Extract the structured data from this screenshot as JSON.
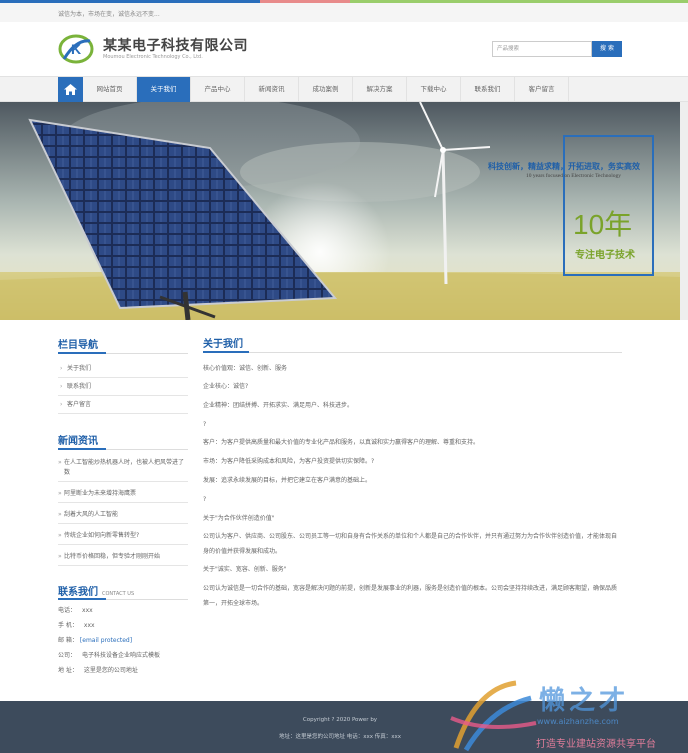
{
  "topbar": {
    "slogan": "诚信为本，市场在变，诚信永远不变...",
    "stripe_colors": [
      "#2a6ebb",
      "#e88b8b",
      "#9acd6b"
    ]
  },
  "header": {
    "company_name": "某某电子科技有限公司",
    "company_name_en": "Moumou Electronic Technology Co., Ltd.",
    "logo_letter": "K"
  },
  "search": {
    "placeholder": "产品搜索",
    "button": "搜 索"
  },
  "nav": {
    "home_icon": "home-icon",
    "items": [
      "网站首页",
      "关于我们",
      "产品中心",
      "新闻资讯",
      "成功案例",
      "解决方案",
      "下载中心",
      "联系我们",
      "客户留言"
    ],
    "active": 1
  },
  "banner": {
    "line1": "科技创新，精益求精，开拓进取，务实高效",
    "line2": "10 years focused on Electronic Technology",
    "big": "10年",
    "sub": "专注电子技术"
  },
  "sidebar": {
    "category_title": "栏目导航",
    "categories": [
      "关于我们",
      "联系我们",
      "客户留言"
    ],
    "news_title": "新闻资讯",
    "news": [
      "在人工智能炒热机器人时，也被人把风带进了数",
      "阿里断业为未来增持海鹰票",
      "刮着大风的人工智能",
      "传统企业如何向新零售转型?",
      "比特币价格回稳，但专验才刚刚开始"
    ],
    "contact_title": "联系我们",
    "contact_title_en": "CONTACT US",
    "contact": [
      {
        "label": "电话：",
        "value": "xxx"
      },
      {
        "label": "手 机：",
        "value": "xxx"
      },
      {
        "label": "邮 箱：",
        "value": "[email protected]"
      },
      {
        "label": "公司：",
        "value": "电子科技设备企业响应式模板"
      },
      {
        "label": "地 址：",
        "value": "这里是您的公司地址"
      }
    ]
  },
  "main": {
    "title": "关于我们",
    "paragraphs": [
      "核心价值观：诚信、创新、服务",
      "企业核心：诚信?",
      "企业精神：团结拼搏、开拓求实、满足用户、科技进步。",
      "?",
      "客户：为客户提供高质量和最大价值的专业化产品和服务，以真诚和实力赢得客户的理解、尊重和支持。",
      "市场：为客户降低采购成本和风险，为客户投资提供切实保障。?",
      "发展：追求永续发展的目标，并把它建立在客户满意的基础上。",
      "?",
      "关于\"为合作伙伴创造价值\"",
      "公司认为客户、供应商、公司股东、公司员工等一切和自身有合作关系的单位和个人都是自己的合作伙伴，并只有通过努力为合作伙伴创造价值，才能体现自身的价值并获得发展和成功。",
      "关于\"诚实、宽容、创新、服务\"",
      "公司认为诚信是一切合作的基础，宽容是解决问题的前提，创新是发展事业的利器，服务是创造价值的根本。公司会坚持持续改进，满足顾客期望，确保品质第一，开拓全球市场。"
    ]
  },
  "footer": {
    "copyright": "Copyright ? 2020 Power by",
    "info": "地址：这里是您的公司地址   电话：xxx   传真：xxx"
  },
  "watermark": {
    "title": "懒之才",
    "url": "www.aizhanzhe.com",
    "slogan": "打造专业建站资源共享平台"
  }
}
